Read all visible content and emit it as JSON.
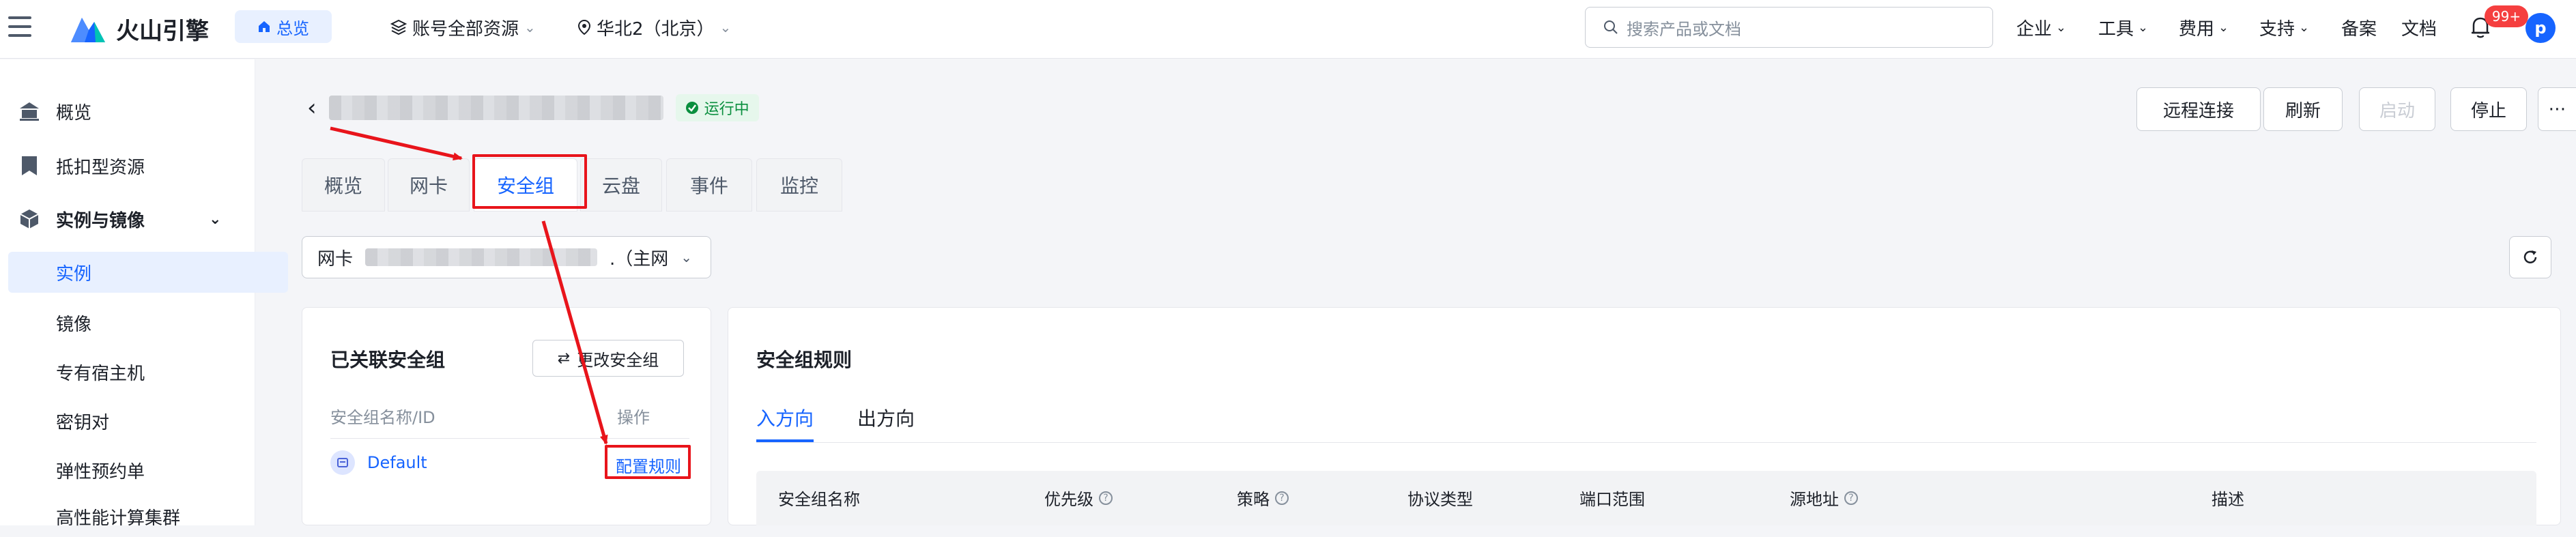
{
  "topbar": {
    "brand": "火山引擎",
    "home_tag": "总览",
    "account_scope": "账号全部资源",
    "region": "华北2（北京）",
    "search_placeholder": "搜索产品或文档",
    "nav": [
      "企业",
      "工具",
      "费用",
      "支持",
      "备案",
      "文档"
    ],
    "notification_count": "99+",
    "avatar_letter": "p"
  },
  "sidebar": {
    "items": [
      {
        "label": "概览"
      },
      {
        "label": "抵扣型资源"
      },
      {
        "label": "实例与镜像"
      },
      {
        "label": "实例"
      },
      {
        "label": "镜像"
      },
      {
        "label": "专有宿主机"
      },
      {
        "label": "密钥对"
      },
      {
        "label": "弹性预约单"
      },
      {
        "label": "高性能计算集群"
      }
    ]
  },
  "instance": {
    "status": "运行中",
    "actions": [
      "远程连接",
      "刷新",
      "启动",
      "停止"
    ]
  },
  "tabs": [
    "概览",
    "网卡",
    "安全组",
    "云盘",
    "事件",
    "监控"
  ],
  "nic": {
    "label": "网卡",
    "suffix": ".（主网"
  },
  "bound_sg": {
    "title": "已关联安全组",
    "change_button": "更改安全组",
    "col_name": "安全组名称/ID",
    "col_action": "操作",
    "row_name": "Default",
    "row_action": "配置规则"
  },
  "rules": {
    "title": "安全组规则",
    "directions": [
      "入方向",
      "出方向"
    ],
    "columns": [
      "安全组名称",
      "优先级",
      "策略",
      "协议类型",
      "端口范围",
      "源地址",
      "描述"
    ]
  },
  "colors": {
    "accent": "#1664ff",
    "annotation": "#e8141b",
    "running": "#0a8f3e"
  }
}
